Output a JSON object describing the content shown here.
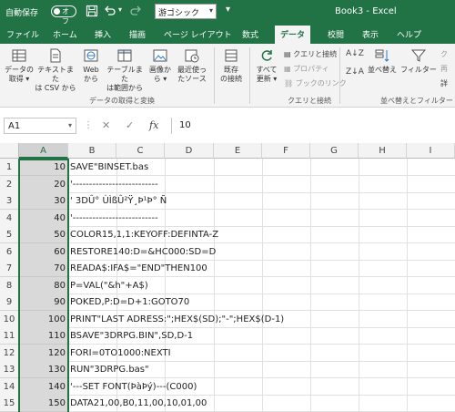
{
  "titlebar": {
    "autosave_label": "自動保存",
    "autosave_state": "オフ",
    "font_name": "游ゴシック",
    "doc_title": "Book3 - Excel"
  },
  "tabs": [
    "ファイル",
    "ホーム",
    "挿入",
    "描画",
    "ページ レイアウト",
    "数式",
    "データ",
    "校閲",
    "表示",
    "ヘルプ"
  ],
  "active_tab": "データ",
  "ribbon": {
    "get_data": {
      "line1": "データの",
      "line2": "取得 ▾"
    },
    "text_csv": {
      "line1": "テキストまた",
      "line2": "は CSV から"
    },
    "web": {
      "line1": "Web",
      "line2": "から"
    },
    "table_range": {
      "line1": "テーブルまた",
      "line2": "は範囲から"
    },
    "from_picture": {
      "line1": "画像か",
      "line2": "ら ▾"
    },
    "recent_sources": {
      "line1": "最近使っ",
      "line2": "たソース"
    },
    "existing_conn": {
      "line1": "既存",
      "line2": "の接続"
    },
    "group_get_transform": "データの取得と変換",
    "refresh_all": {
      "line1": "すべて",
      "line2": "更新 ▾"
    },
    "queries_connections": "クエリと接続",
    "properties": "プロパティ",
    "edit_links": "ブックのリンク",
    "group_queries": "クエリと接続",
    "sort_label": "並べ替え",
    "filter_label": "フィルター",
    "group_sort_filter": "並べ替えとフィルター",
    "clear_short": "ク",
    "reapply_short": "再",
    "advanced_short": "詳"
  },
  "formula_bar": {
    "name_box": "A1",
    "formula": "10"
  },
  "columns": [
    "A",
    "B",
    "C",
    "D",
    "E",
    "F",
    "G",
    "H",
    "I"
  ],
  "rows": [
    {
      "n": "1",
      "a": "10",
      "b": "SAVE\"BINSET.bas"
    },
    {
      "n": "2",
      "a": "20",
      "b": "'--------------------------"
    },
    {
      "n": "3",
      "a": "30",
      "b": "' 3DÛ°  ÙÌßÛ²Ÿ¸Þ¹Þ°  Ñ"
    },
    {
      "n": "4",
      "a": "40",
      "b": "'--------------------------"
    },
    {
      "n": "5",
      "a": "50",
      "b": "COLOR15,1,1:KEYOFF:DEFINTA-Z"
    },
    {
      "n": "6",
      "a": "60",
      "b": "RESTORE140:D=&HC000:SD=D"
    },
    {
      "n": "7",
      "a": "70",
      "b": "READA$:IFA$=\"END\"THEN100"
    },
    {
      "n": "8",
      "a": "80",
      "b": "P=VAL(\"&h\"+A$)"
    },
    {
      "n": "9",
      "a": "90",
      "b": "POKED,P:D=D+1:GOTO70"
    },
    {
      "n": "10",
      "a": "100",
      "b": "PRINT\"LAST ADRESS:\";HEX$(SD);\"-\";HEX$(D-1)"
    },
    {
      "n": "11",
      "a": "110",
      "b": "BSAVE\"3DRPG.BIN\",SD,D-1"
    },
    {
      "n": "12",
      "a": "120",
      "b": "FORI=0TO1000:NEXTI"
    },
    {
      "n": "13",
      "a": "130",
      "b": "RUN\"3DRPG.bas\""
    },
    {
      "n": "14",
      "a": "140",
      "b": "'---SET FONT(ÞàÞý)---(C000)"
    },
    {
      "n": "15",
      "a": "150",
      "b": "DATA21,00,B0,11,00,10,01,00"
    }
  ],
  "colors": {
    "excel_green": "#217346",
    "selection_gray": "#d9d9d9"
  }
}
